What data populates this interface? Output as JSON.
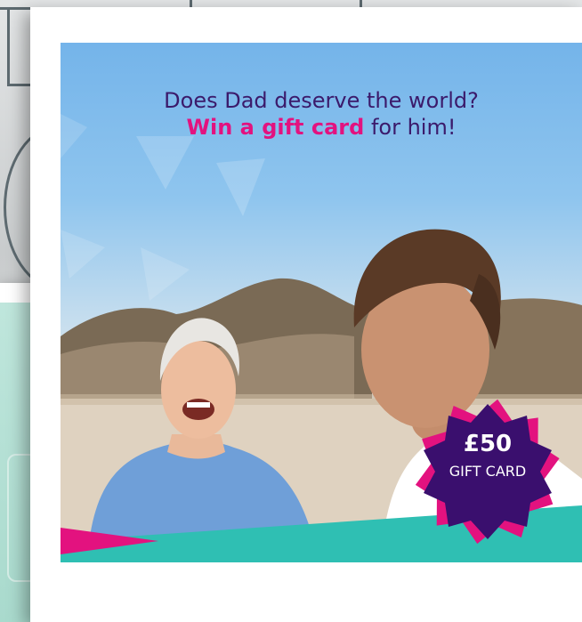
{
  "ad": {
    "headline_line1": "Does Dad deserve the world?",
    "headline_highlight": "Win a gift card",
    "headline_rest": " for him!",
    "badge_amount": "£50",
    "badge_label": "GIFT CARD"
  },
  "colors": {
    "headline": "#3b1a6b",
    "highlight": "#e3127f",
    "badge": "#3a0f6e",
    "teal": "#2fbfb3",
    "pink": "#e3127f",
    "mint": "#a9dacd"
  }
}
